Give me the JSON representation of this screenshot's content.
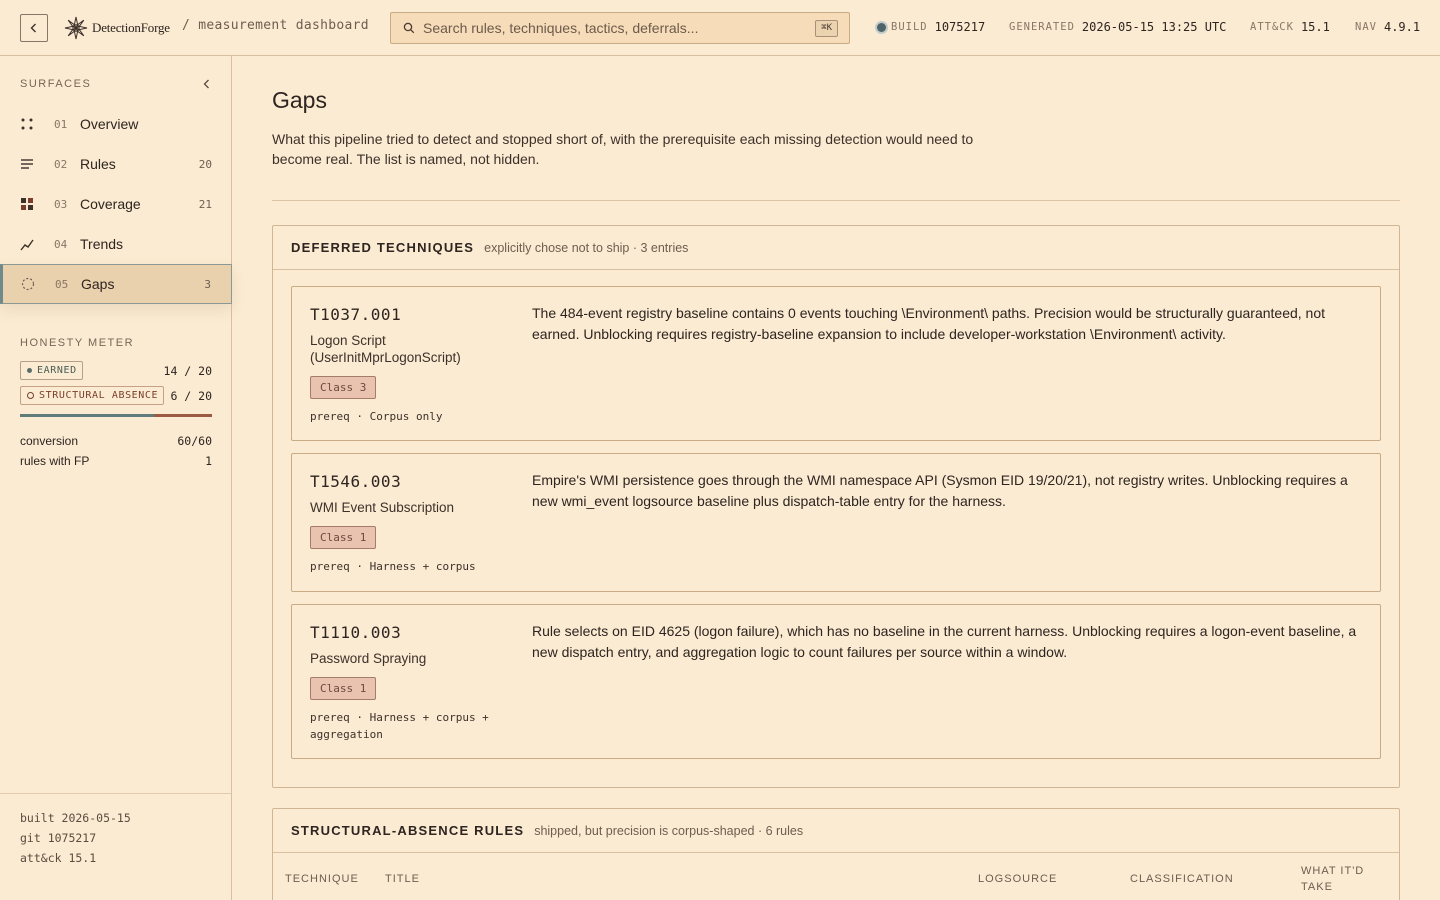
{
  "header": {
    "brand": "DetectionForge",
    "breadcrumb": "/ measurement dashboard",
    "search_placeholder": "Search rules, techniques, tactics, deferrals...",
    "search_shortcut": "⌘K",
    "meta": [
      {
        "key": "BUILD",
        "value": "1075217"
      },
      {
        "key": "GENERATED",
        "value": "2026-05-15 13:25 UTC"
      },
      {
        "key": "ATT&CK",
        "value": "15.1"
      },
      {
        "key": "NAV",
        "value": "4.9.1"
      }
    ],
    "icons": {
      "back": "chevron-left-icon",
      "brand": "flower-logo",
      "search": "search-icon",
      "status": "status-dot-icon"
    }
  },
  "sidebar": {
    "section_label": "SURFACES",
    "items": [
      {
        "num": "01",
        "label": "Overview",
        "count": "",
        "icon": "dots-grid-icon"
      },
      {
        "num": "02",
        "label": "Rules",
        "count": "20",
        "icon": "lines-icon"
      },
      {
        "num": "03",
        "label": "Coverage",
        "count": "21",
        "icon": "heatmap-icon"
      },
      {
        "num": "04",
        "label": "Trends",
        "count": "",
        "icon": "trend-line-icon"
      },
      {
        "num": "05",
        "label": "Gaps",
        "count": "3",
        "icon": "dashed-circle-icon"
      }
    ],
    "active_index": 4,
    "honesty": {
      "title": "HONESTY METER",
      "earned_label": "EARNED",
      "earned_value": "14 / 20",
      "earned_fraction": 0.7,
      "structural_label": "STRUCTURAL ABSENCE",
      "structural_value": "6 / 20",
      "stats": [
        {
          "key": "conversion",
          "value": "60/60"
        },
        {
          "key": "rules with FP",
          "value": "1"
        }
      ]
    },
    "footer": [
      "built 2026-05-15",
      "git 1075217",
      "att&ck 15.1"
    ]
  },
  "main": {
    "title": "Gaps",
    "description": "What this pipeline tried to detect and stopped short of, with the prerequisite each missing detection would need to become real. The list is named, not hidden.",
    "deferred": {
      "title": "DEFERRED TECHNIQUES",
      "subtitle": "explicitly chose not to ship · 3 entries",
      "cards": [
        {
          "id": "T1037.001",
          "name": "Logon Script (UserInitMprLogonScript)",
          "class": "Class 3",
          "prereq": "prereq · Corpus only",
          "text": "The 484-event registry baseline contains 0 events touching \\Environment\\ paths. Precision would be structurally guaranteed, not earned. Unblocking requires registry-baseline expansion to include developer-workstation \\Environment\\ activity."
        },
        {
          "id": "T1546.003",
          "name": "WMI Event Subscription",
          "class": "Class 1",
          "prereq": "prereq · Harness + corpus",
          "text": "Empire's WMI persistence goes through the WMI namespace API (Sysmon EID 19/20/21), not registry writes. Unblocking requires a new wmi_event logsource baseline plus dispatch-table entry for the harness."
        },
        {
          "id": "T1110.003",
          "name": "Password Spraying",
          "class": "Class 1",
          "prereq": "prereq · Harness + corpus + aggregation",
          "text": "Rule selects on EID 4625 (logon failure), which has no baseline in the current harness. Unblocking requires a logon-event baseline, a new dispatch entry, and aggregation logic to count failures per source within a window."
        }
      ]
    },
    "structural": {
      "title": "STRUCTURAL-ABSENCE RULES",
      "subtitle": "shipped, but precision is corpus-shaped · 6 rules",
      "columns": [
        "TECHNIQUE",
        "TITLE",
        "LOGSOURCE",
        "CLASSIFICATION",
        "WHAT IT'D TAKE"
      ]
    }
  }
}
